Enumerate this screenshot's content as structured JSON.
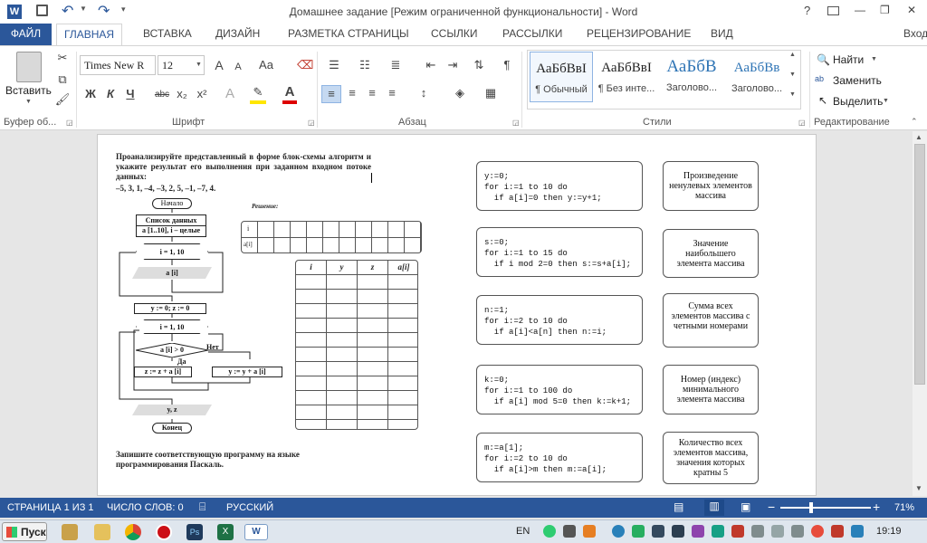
{
  "window": {
    "title": "Домашнее задание [Режим ограниченной функциональности] - Word",
    "help": "?",
    "minimize": "—",
    "restore": "❐",
    "close": "✕"
  },
  "tabs": [
    "ФАЙЛ",
    "ГЛАВНАЯ",
    "ВСТАВКА",
    "ДИЗАЙН",
    "РАЗМЕТКА СТРАНИЦЫ",
    "ССЫЛКИ",
    "РАССЫЛКИ",
    "РЕЦЕНЗИРОВАНИЕ",
    "ВИД"
  ],
  "signin": "Вход",
  "ribbon": {
    "clipboard": {
      "paste": "Вставить",
      "label": "Буфер об..."
    },
    "font": {
      "name": "Times New R",
      "size": "12",
      "label": "Шрифт",
      "bold": "Ж",
      "italic": "К",
      "underline": "Ч",
      "strike": "abc",
      "sub": "x₂",
      "sup": "x²",
      "grow": "A",
      "shrink": "A",
      "case": "Aa"
    },
    "paragraph": {
      "label": "Абзац"
    },
    "styles": {
      "label": "Стили",
      "items": [
        {
          "sample": "АаБбВвІ",
          "name": "¶ Обычный"
        },
        {
          "sample": "АаБбВвІ",
          "name": "¶ Без инте..."
        },
        {
          "sample": "АаБбВ",
          "name": "Заголово..."
        },
        {
          "sample": "АаБбВв",
          "name": "Заголово..."
        }
      ]
    },
    "editing": {
      "label": "Редактирование",
      "find": "Найти",
      "replace": "Заменить",
      "select": "Выделить"
    }
  },
  "doc": {
    "task": "Проанализируйте представленный в форме блок-схемы алгоритм и укажите результат его выполнения при заданном входном потоке данных:",
    "input": "–5, 3, 1, –4, –3, 2, 5, –1, –7, 4.",
    "solution_label": "Решение:",
    "row_i": "i",
    "row_ai": "a[i]",
    "table_headers": [
      "i",
      "y",
      "z",
      "a[i]"
    ],
    "flow": {
      "start": "Начало",
      "data_list": "Список данных",
      "data_desc": "a [1..10], i – целые",
      "loop1": "i = 1, 10",
      "read": "a [i]",
      "init": "y := 0; z := 0",
      "loop2": "i = 1, 10",
      "cond": "a [i] > 0",
      "no": "Нет",
      "yes": "Да",
      "z_assign": "z := z + a [i]",
      "y_assign": "y := y + a [i]",
      "output": "y, z",
      "end": "Конец"
    },
    "program_task": "Запишите соответствующую программу на языке программирования Паскаль.",
    "code_blocks": [
      [
        "y:=0;",
        "for i:=1 to 10 do",
        "  if a[i]=0 then y:=y+1;"
      ],
      [
        "s:=0;",
        "for i:=1 to 15 do",
        "  if i mod 2=0 then s:=s+a[i];"
      ],
      [
        "n:=1;",
        "for i:=2 to 10 do",
        "  if a[i]<a[n] then n:=i;"
      ],
      [
        "k:=0;",
        "for i:=1 to 100 do",
        "  if a[i] mod 5=0 then k:=k+1;"
      ],
      [
        "m:=a[1];",
        "for i:=2 to 10 do",
        "  if a[i]>m then m:=a[i];"
      ]
    ],
    "answers": [
      "Произведение ненулевых элементов массива",
      "Значение наибольшего элемента массива",
      "Сумма всех элементов массива с четными номерами",
      "Номер (индекс) минимального элемента массива",
      "Количество всех элементов массива, значения которых кратны 5"
    ]
  },
  "status": {
    "page": "СТРАНИЦА 1 ИЗ 1",
    "words": "ЧИСЛО СЛОВ: 0",
    "lang": "РУССКИЙ",
    "zoom": "71%"
  },
  "taskbar": {
    "start": "Пуск",
    "lang": "EN",
    "time": "19:19"
  }
}
